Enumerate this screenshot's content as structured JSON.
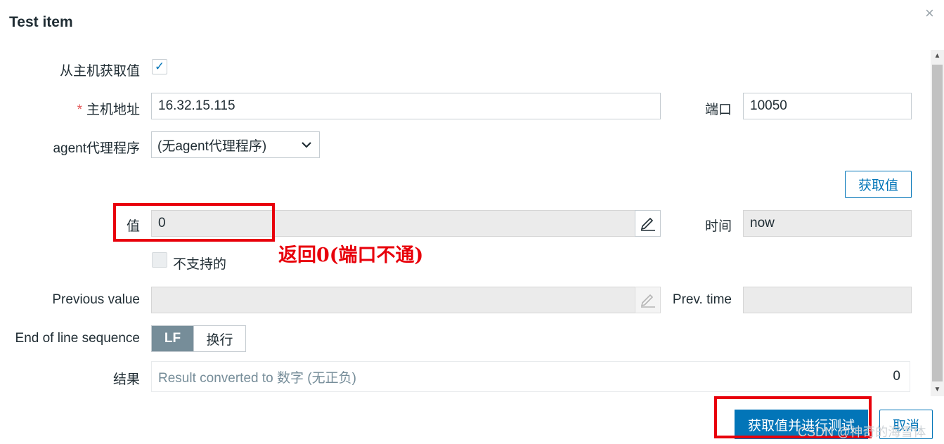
{
  "dialog": {
    "title": "Test item",
    "close_glyph": "×"
  },
  "get_from_host": {
    "label": "从主机获取值",
    "checked": true,
    "check_glyph": "✓"
  },
  "host": {
    "required_mark": "*",
    "label": "主机地址",
    "value": "16.32.15.115"
  },
  "port": {
    "label": "端口",
    "value": "10050"
  },
  "proxy": {
    "label": "agent代理程序",
    "selected": "(无agent代理程序)",
    "chevron": "⌄"
  },
  "get_value_button": "获取值",
  "value": {
    "label": "值",
    "value": "0"
  },
  "time": {
    "label": "时间",
    "value": "now"
  },
  "not_supported": {
    "label": "不支持的",
    "checked": false
  },
  "annotation": "返回0(端口不通)",
  "previous_value": {
    "label": "Previous value",
    "value": ""
  },
  "prev_time": {
    "label": "Prev. time",
    "value": ""
  },
  "eol": {
    "label": "End of line sequence",
    "options": [
      "LF",
      "换行"
    ],
    "selected": "LF"
  },
  "result": {
    "label": "结果",
    "placeholder": "Result converted to 数字 (无正负)",
    "value": "0"
  },
  "buttons": {
    "get_and_test": "获取值并进行测试",
    "cancel": "取消"
  },
  "watermark": "CSDN @神奇的海雪体",
  "colors": {
    "accent": "#0275b8",
    "annotation_red": "#e8000b",
    "segment_active": "#768d99"
  },
  "icons": {
    "pencil": "pencil-icon",
    "close": "close-icon",
    "check": "check-icon",
    "chevron": "chevron-down-icon"
  }
}
